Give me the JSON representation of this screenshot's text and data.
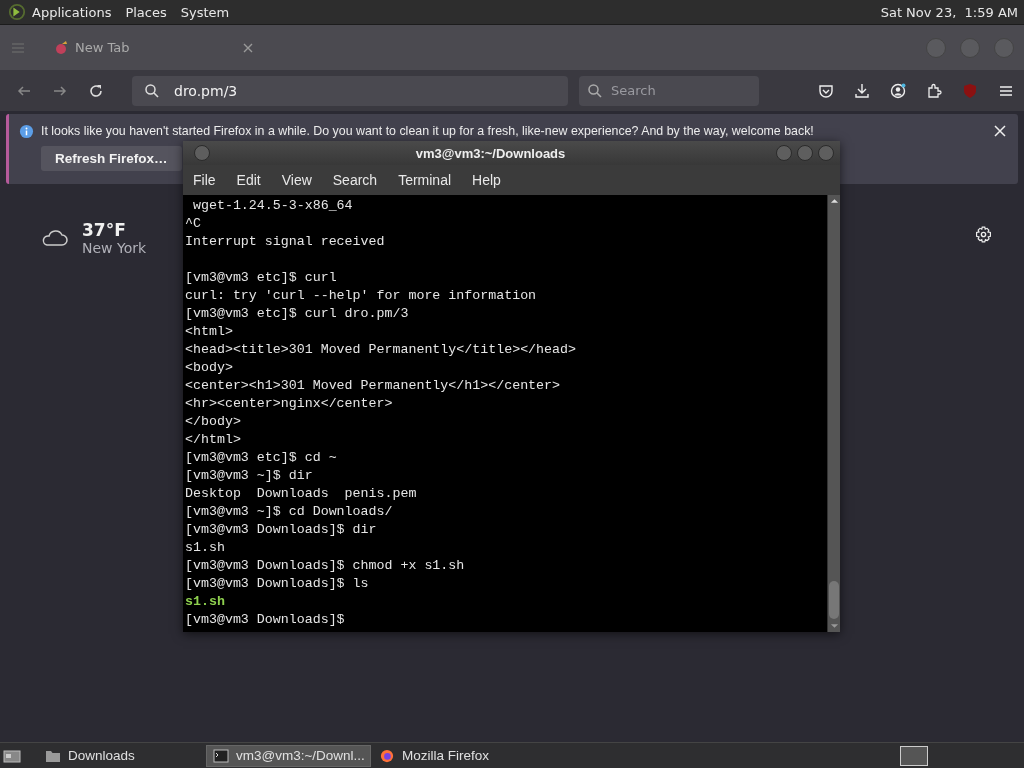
{
  "top_panel": {
    "menus": [
      "Applications",
      "Places",
      "System"
    ],
    "clock": "Sat Nov 23,  1:59 AM"
  },
  "browser": {
    "tab": {
      "title": "New Tab"
    },
    "address": {
      "value": "dro.pm/3"
    },
    "search": {
      "placeholder": "Search"
    },
    "notification": {
      "message": "It looks like you haven't started Firefox in a while. Do you want to clean it up for a fresh, like-new experience? And by the way, welcome back!",
      "button": "Refresh Firefox…"
    },
    "weather": {
      "temperature": "37°F",
      "location": "New York"
    }
  },
  "terminal": {
    "title": "vm3@vm3:~/Downloads",
    "menus": [
      "File",
      "Edit",
      "View",
      "Search",
      "Terminal",
      "Help"
    ],
    "lines": [
      {
        "kind": "text",
        "text": " wget-1.24.5-3-x86_64"
      },
      {
        "kind": "text",
        "text": "^C"
      },
      {
        "kind": "text",
        "text": "Interrupt signal received"
      },
      {
        "kind": "blank"
      },
      {
        "kind": "text",
        "text": "[vm3@vm3 etc]$ curl"
      },
      {
        "kind": "text",
        "text": "curl: try 'curl --help' for more information"
      },
      {
        "kind": "text",
        "text": "[vm3@vm3 etc]$ curl dro.pm/3"
      },
      {
        "kind": "text",
        "text": "<html>"
      },
      {
        "kind": "text",
        "text": "<head><title>301 Moved Permanently</title></head>"
      },
      {
        "kind": "text",
        "text": "<body>"
      },
      {
        "kind": "text",
        "text": "<center><h1>301 Moved Permanently</h1></center>"
      },
      {
        "kind": "text",
        "text": "<hr><center>nginx</center>"
      },
      {
        "kind": "text",
        "text": "</body>"
      },
      {
        "kind": "text",
        "text": "</html>"
      },
      {
        "kind": "text",
        "text": "[vm3@vm3 etc]$ cd ~"
      },
      {
        "kind": "text",
        "text": "[vm3@vm3 ~]$ dir"
      },
      {
        "kind": "text",
        "text": "Desktop  Downloads  penis.pem"
      },
      {
        "kind": "text",
        "text": "[vm3@vm3 ~]$ cd Downloads/"
      },
      {
        "kind": "text",
        "text": "[vm3@vm3 Downloads]$ dir"
      },
      {
        "kind": "text",
        "text": "s1.sh"
      },
      {
        "kind": "text",
        "text": "[vm3@vm3 Downloads]$ chmod +x s1.sh"
      },
      {
        "kind": "text",
        "text": "[vm3@vm3 Downloads]$ ls"
      },
      {
        "kind": "executable",
        "text": "s1.sh"
      },
      {
        "kind": "text",
        "text": "[vm3@vm3 Downloads]$"
      }
    ]
  },
  "taskbar": {
    "items": [
      {
        "kind": "folder",
        "label": "Downloads",
        "selected": false
      },
      {
        "kind": "terminal",
        "label": "vm3@vm3:~/Downl...",
        "selected": true
      },
      {
        "kind": "browser",
        "label": "Mozilla Firefox",
        "selected": false
      }
    ]
  }
}
